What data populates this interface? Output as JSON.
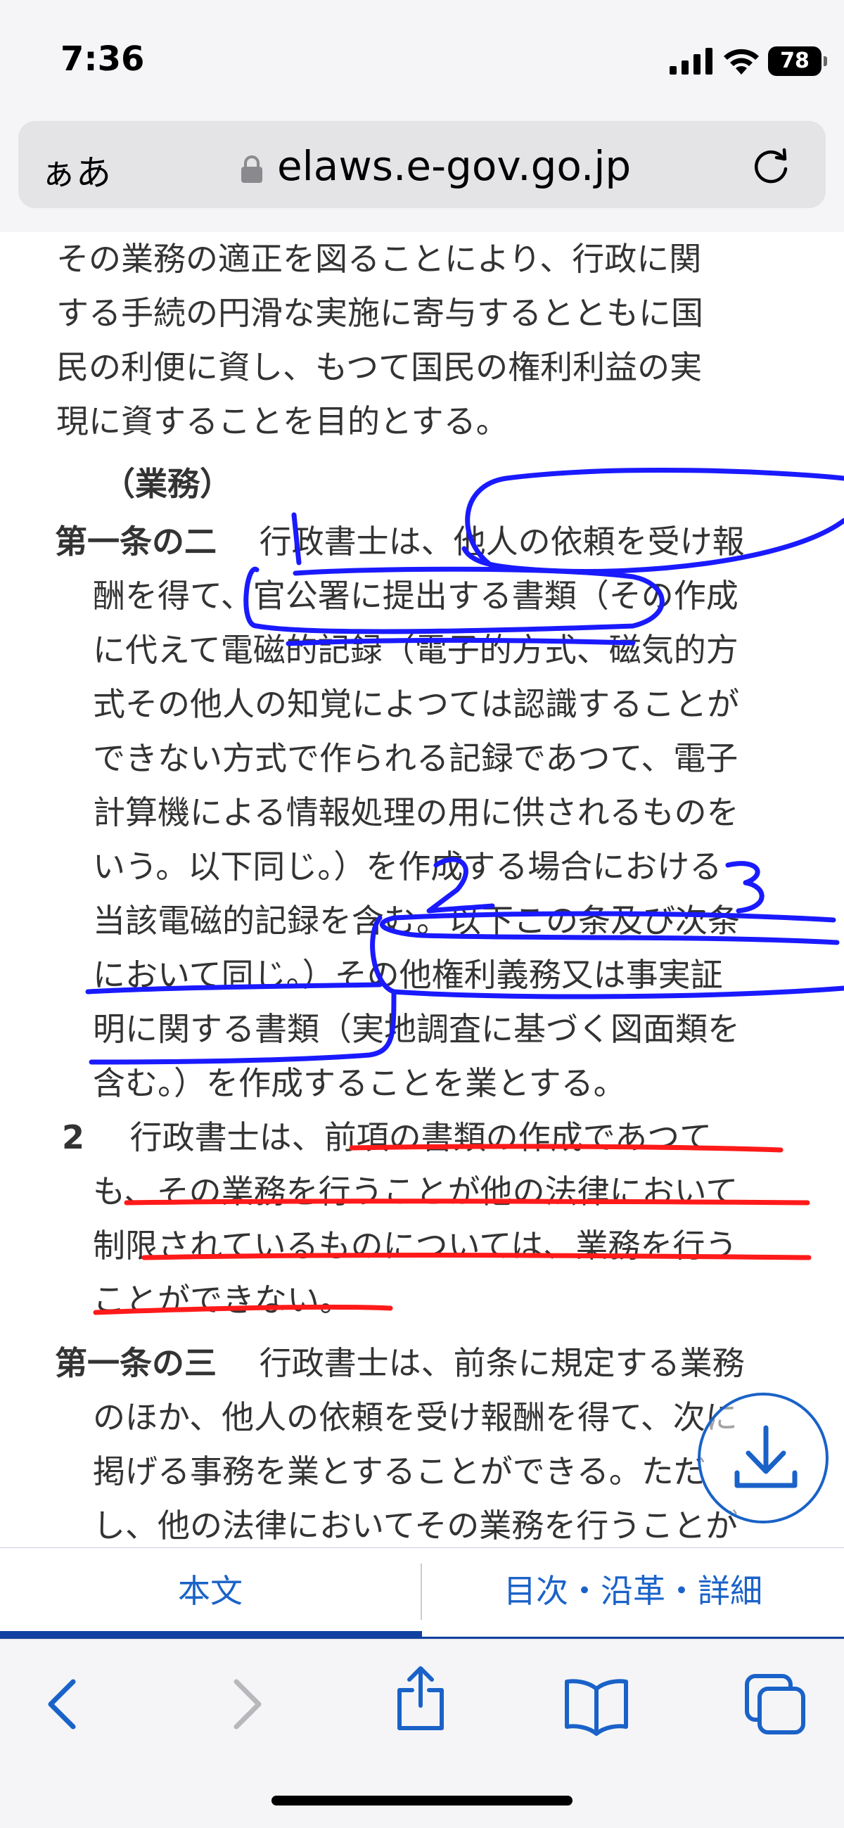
{
  "status": {
    "time": "7:36",
    "battery": "78"
  },
  "browser": {
    "text_size": "ぁあ",
    "domain": "elaws.e-gov.go.jp"
  },
  "article": {
    "prev_lines": [
      "その業務の適正を図ることにより、行政に関",
      "する手続の円滑な実施に寄与するとともに国",
      "民の利便に資し、もつて国民の権利利益の実",
      "現に資することを目的とする。"
    ],
    "caption": "（業務）",
    "a12_label": "第一条の二",
    "a12_lines": [
      "行政書士は、他人の依頼を受け報",
      "酬を得て、官公署に提出する書類（その作成",
      "に代えて電磁的記録（電子的方式、磁気的方",
      "式その他人の知覚によつては認識することが",
      "できない方式で作られる記録であつて、電子",
      "計算機による情報処理の用に供されるものを",
      "いう。以下同じ。）を作成する場合における",
      "当該電磁的記録を含む。以下この条及び次条",
      "において同じ。）その他権利義務又は事実証",
      "明に関する書類（実地調査に基づく図面類を",
      "含む。）を作成することを業とする。"
    ],
    "p2_num": "2",
    "p2_lines": [
      "行政書士は、前項の書類の作成であつて",
      "も、その業務を行うことが他の法律において",
      "制限されているものについては、業務を行う",
      "ことができない。"
    ],
    "a13_label": "第一条の三",
    "a13_lines": [
      "行政書士は、前条に規定する業務",
      "のほか、他人の依頼を受け報酬を得て、次に",
      "掲げる事務を業とすることができる。ただ",
      "し、他の法律においてその業務を行うことが"
    ]
  },
  "annotations": {
    "numbers": [
      "1",
      "2",
      "3"
    ],
    "colors": {
      "blue": "#1a1aff",
      "red": "#ff1a1a"
    }
  },
  "tabs": {
    "main": "本文",
    "toc": "目次・沿革・詳細"
  },
  "colors": {
    "link": "#1a62c8",
    "tab_indicator": "#1140a0"
  }
}
